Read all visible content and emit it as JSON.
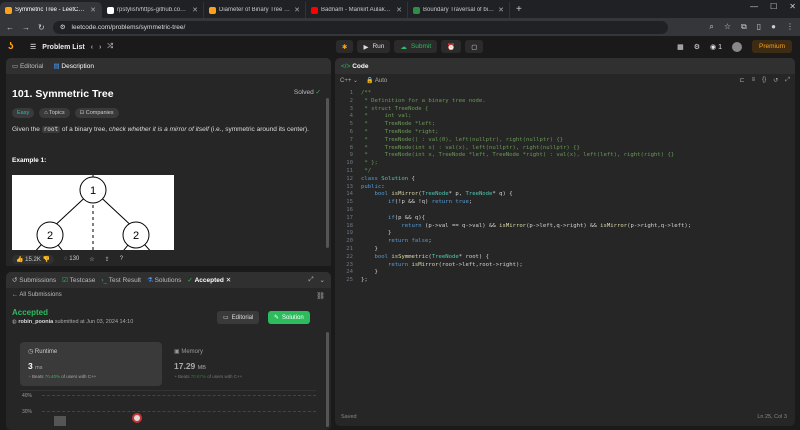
{
  "browser": {
    "tabs": [
      {
        "title": "Symmetric Tree - LeetCode",
        "color": "#ffa116",
        "active": true
      },
      {
        "title": "rpstylish/https-github.com-rpst",
        "color": "#ffffff",
        "active": false
      },
      {
        "title": "Diameter of Binary Tree - LeetC",
        "color": "#ffa116",
        "active": false
      },
      {
        "title": "Badnam - Mankirt Aulakh (HD V",
        "color": "#ff0000",
        "active": false
      },
      {
        "title": "Boundary Traversal of binary tre",
        "color": "#2f8d46",
        "active": false
      }
    ],
    "url": "leetcode.com/problems/symmetric-tree/"
  },
  "nav": {
    "problem_list": "Problem List",
    "run": "Run",
    "submit": "Submit",
    "streak": "1",
    "premium": "Premium"
  },
  "description": {
    "tab_editorial": "Editorial",
    "tab_description": "Description",
    "title": "101. Symmetric Tree",
    "status": "Solved",
    "tags": [
      "Easy",
      "Topics",
      "Companies"
    ],
    "text_pre": "Given the ",
    "text_code": "root",
    "text_mid": " of a binary tree, ",
    "text_em": "check whether it is a mirror of itself",
    "text_post": " (i.e., symmetric around its center).",
    "example": "Example 1:",
    "tree_nodes": [
      "1",
      "2",
      "2"
    ],
    "likes": "15.2K",
    "comments": "130"
  },
  "submissions": {
    "tabs": [
      "Submissions",
      "Testcase",
      "Test Result",
      "Solutions",
      "Accepted"
    ],
    "all": "All Submissions",
    "result": "Accepted",
    "user": "robin_poonia",
    "submitted": "submitted at Jun 03, 2024 14:10",
    "editorial_btn": "Editorial",
    "solution_btn": "Solution",
    "runtime_label": "Runtime",
    "runtime_value": "3",
    "runtime_unit": "ms",
    "runtime_beats_label": "Beats",
    "runtime_beats": "70.40%",
    "runtime_beats_suffix": "of users with C++",
    "memory_label": "Memory",
    "memory_value": "17.29",
    "memory_unit": "MB",
    "memory_beats_label": "Beats",
    "memory_beats": "70.87%",
    "memory_beats_suffix": "of users with C++",
    "axis": [
      "40%",
      "30%"
    ]
  },
  "code": {
    "title": "Code",
    "lang": "C++",
    "auto": "Auto",
    "status": "Saved",
    "cursor": "Ln 25, Col 3",
    "lines": [
      "/**",
      " * Definition for a binary tree node.",
      " * struct TreeNode {",
      " *     int val;",
      " *     TreeNode *left;",
      " *     TreeNode *right;",
      " *     TreeNode() : val(0), left(nullptr), right(nullptr) {}",
      " *     TreeNode(int x) : val(x), left(nullptr), right(nullptr) {}",
      " *     TreeNode(int x, TreeNode *left, TreeNode *right) : val(x), left(left), right(right) {}",
      " * };",
      " */",
      "class Solution {",
      "public:",
      "    bool isMirror(TreeNode* p, TreeNode* q) {",
      "        if(!p && !q) return true;",
      "",
      "        if(p && q){",
      "            return (p->val == q->val) && isMirror(p->left,q->right) && isMirror(p->right,q->left);",
      "        }",
      "        return false;",
      "    }",
      "    bool isSymmetric(TreeNode* root) {",
      "        return isMirror(root->left,root->right);",
      "    }",
      "};"
    ]
  }
}
